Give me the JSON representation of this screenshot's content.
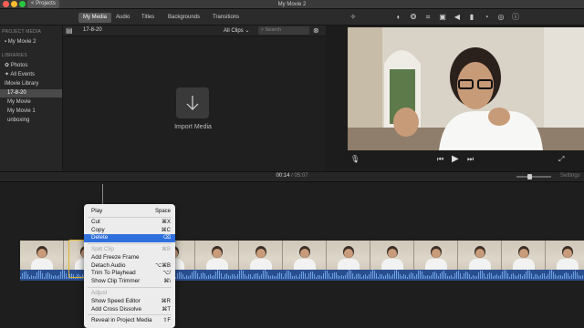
{
  "window": {
    "title": "My Movie 2",
    "projects_button": "< Projects"
  },
  "tabs": [
    "My Media",
    "Audio",
    "Titles",
    "Backgrounds",
    "Transitions"
  ],
  "sidebar": {
    "project_media_header": "PROJECT MEDIA",
    "project_item": "My Movie 2",
    "libraries_header": "LIBRARIES",
    "items": [
      "Photos",
      "All Events",
      "iMovie Library",
      "17-8-20",
      "My Movie",
      "My Movie 1",
      "unboxing"
    ]
  },
  "browser": {
    "date": "17-8-20",
    "filter": "All Clips",
    "search_placeholder": "Search",
    "import_label": "Import Media"
  },
  "timeline": {
    "timecode_current": "00:14",
    "timecode_sep": "/",
    "timecode_total": "05:07",
    "settings": "Settings"
  },
  "context_menu": {
    "items": [
      {
        "label": "Play",
        "shortcut": "Space",
        "enabled": true
      },
      {
        "label": "Cut",
        "shortcut": "⌘X",
        "enabled": true
      },
      {
        "label": "Copy",
        "shortcut": "⌘C",
        "enabled": true
      },
      {
        "label": "Delete",
        "shortcut": "⌫",
        "enabled": true,
        "highlighted": true
      },
      {
        "label": "Split Clip",
        "shortcut": "⌘B",
        "enabled": false
      },
      {
        "label": "Add Freeze Frame",
        "shortcut": "",
        "enabled": true
      },
      {
        "label": "Detach Audio",
        "shortcut": "⌥⌘B",
        "enabled": true
      },
      {
        "label": "Trim To Playhead",
        "shortcut": "⌥/",
        "enabled": true
      },
      {
        "label": "Show Clip Trimmer",
        "shortcut": "⌘\\",
        "enabled": true
      },
      {
        "label": "Adjust",
        "shortcut": "",
        "enabled": false
      },
      {
        "label": "Show Speed Editor",
        "shortcut": "⌘R",
        "enabled": true
      },
      {
        "label": "Add Cross Dissolve",
        "shortcut": "⌘T",
        "enabled": true
      },
      {
        "label": "Reveal in Project Media",
        "shortcut": "⇧F",
        "enabled": true
      }
    ]
  },
  "colors": {
    "accent": "#2f6fde",
    "selection": "#e3b530",
    "audio": "#2a4f8f"
  }
}
